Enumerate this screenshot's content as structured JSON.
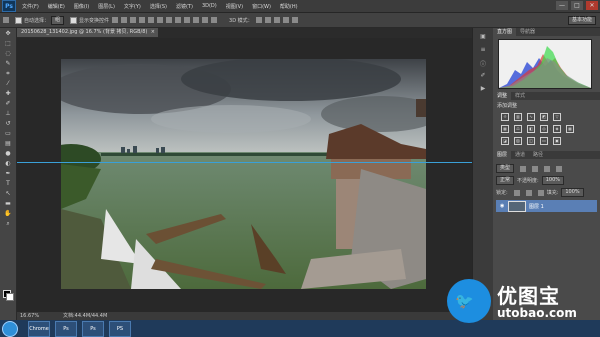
{
  "app": {
    "logo_text": "Ps"
  },
  "menu": {
    "items": [
      "文件(F)",
      "编辑(E)",
      "图像(I)",
      "图层(L)",
      "文字(Y)",
      "选择(S)",
      "滤镜(T)",
      "3D(D)",
      "视图(V)",
      "窗口(W)",
      "帮助(H)"
    ]
  },
  "window_controls": {
    "minimize": "—",
    "maximize": "□",
    "close": "✕"
  },
  "options": {
    "auto_select_label": "自动选择：",
    "auto_select_value": "组",
    "show_transform_label": "显示变换控件",
    "mode_3d_label": "3D 模式：",
    "workspace_value": "基本功能"
  },
  "document": {
    "tab_title": "20150628_131402.jpg @ 16.7% (背景 拷贝, RGB/8)",
    "tab_close": "×"
  },
  "status": {
    "zoom": "16.67%",
    "doc_size": "文档:44.4M/44.4M"
  },
  "panels": {
    "top_tabs": [
      "直方图",
      "导航器"
    ],
    "adjust_tabs": [
      "调整",
      "样式"
    ],
    "adjust_title": "添加调整",
    "layer_tabs": [
      "图层",
      "通道",
      "路径"
    ],
    "kind_label": "类型",
    "blend_mode": "正常",
    "opacity_label": "不透明度:",
    "opacity_value": "100%",
    "lock_label": "锁定:",
    "fill_label": "填充:",
    "fill_value": "100%",
    "layer_name": "图层 1"
  },
  "taskbar": {
    "items": [
      "Chrome",
      "Ps",
      "Ps",
      "PS"
    ]
  },
  "watermark": {
    "brand_cn": "优图宝",
    "url": "utobao.com"
  }
}
